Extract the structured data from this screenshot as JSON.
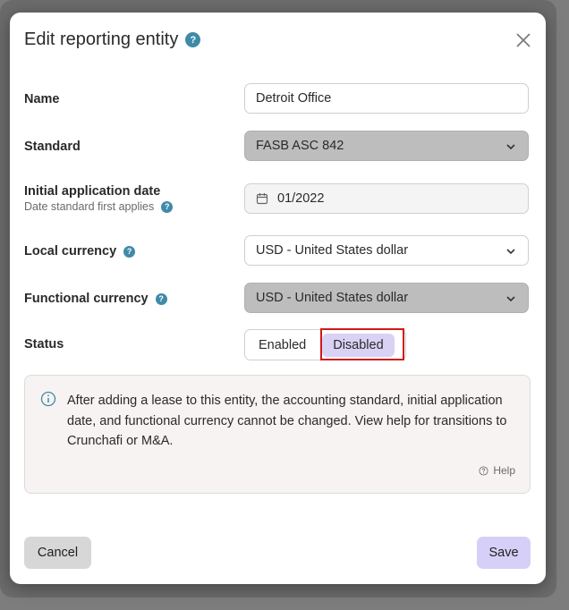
{
  "dialog": {
    "title": "Edit reporting entity",
    "close_icon": "close-icon"
  },
  "form": {
    "name": {
      "label": "Name",
      "value": "Detroit Office"
    },
    "standard": {
      "label": "Standard",
      "value": "FASB ASC 842"
    },
    "initial_date": {
      "label": "Initial application date",
      "sublabel": "Date standard first applies",
      "value": "01/2022"
    },
    "local_currency": {
      "label": "Local currency",
      "value": "USD - United States dollar"
    },
    "functional_currency": {
      "label": "Functional currency",
      "value": "USD - United States dollar"
    },
    "status": {
      "label": "Status",
      "options": [
        "Enabled",
        "Disabled"
      ],
      "selected": "Disabled"
    }
  },
  "info": {
    "text": "After adding a lease to this entity, the accounting standard, initial application date, and functional currency cannot be changed. View help for transitions to Crunchafi or M&A.",
    "help_label": "Help"
  },
  "footer": {
    "cancel_label": "Cancel",
    "save_label": "Save"
  },
  "colors": {
    "accent": "#d6cff7",
    "help_icon": "#3f8aa8",
    "highlight": "#d11a1a"
  }
}
